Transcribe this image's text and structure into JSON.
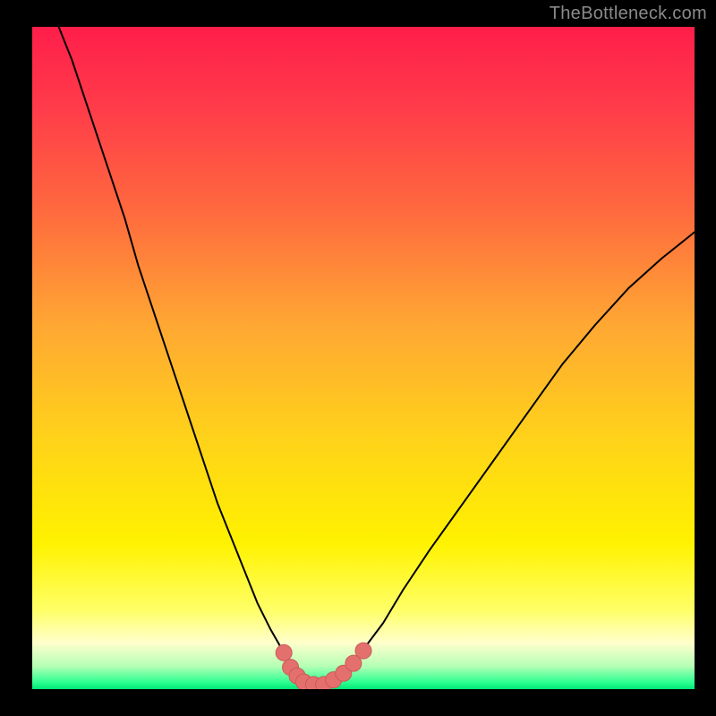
{
  "watermark": "TheBottleneck.com",
  "colors": {
    "background": "#000000",
    "gradient_stops": [
      {
        "offset": 0.0,
        "color": "#ff1e4a"
      },
      {
        "offset": 0.12,
        "color": "#ff3b4a"
      },
      {
        "offset": 0.28,
        "color": "#ff6a3e"
      },
      {
        "offset": 0.45,
        "color": "#ffa733"
      },
      {
        "offset": 0.62,
        "color": "#ffd21a"
      },
      {
        "offset": 0.78,
        "color": "#fff200"
      },
      {
        "offset": 0.88,
        "color": "#ffff66"
      },
      {
        "offset": 0.93,
        "color": "#ffffcc"
      },
      {
        "offset": 0.965,
        "color": "#b6ffb6"
      },
      {
        "offset": 0.99,
        "color": "#2bff90"
      },
      {
        "offset": 1.0,
        "color": "#00e676"
      }
    ],
    "curve": "#000000",
    "marker_fill": "#e4706e",
    "marker_stroke": "#c95a58"
  },
  "chart_data": {
    "type": "line",
    "title": "",
    "xlabel": "",
    "ylabel": "",
    "xlim": [
      0,
      100
    ],
    "ylim": [
      0,
      100
    ],
    "series": [
      {
        "name": "bottleneck-curve",
        "x": [
          4,
          6,
          8,
          10,
          12,
          14,
          16,
          18,
          20,
          22,
          24,
          26,
          28,
          30,
          32,
          34,
          36,
          38,
          39,
          40,
          41,
          42,
          43,
          44,
          45,
          46,
          48,
          50,
          53,
          56,
          60,
          65,
          70,
          75,
          80,
          85,
          90,
          95,
          100
        ],
        "y": [
          100,
          95,
          89,
          83,
          77,
          71,
          64,
          58,
          52,
          46,
          40,
          34,
          28,
          23,
          18,
          13,
          9,
          5.5,
          4,
          2.8,
          1.9,
          1.2,
          0.6,
          0.4,
          0.7,
          1.4,
          3.2,
          6,
          10,
          15,
          21,
          28,
          35,
          42,
          49,
          55,
          60.5,
          65,
          69
        ]
      }
    ],
    "markers": {
      "name": "valley-markers",
      "points": [
        {
          "x": 38.0,
          "y": 5.5
        },
        {
          "x": 39.0,
          "y": 3.3
        },
        {
          "x": 40.0,
          "y": 2
        },
        {
          "x": 41.0,
          "y": 1.1
        },
        {
          "x": 42.5,
          "y": 0.7
        },
        {
          "x": 44.0,
          "y": 0.7
        },
        {
          "x": 45.5,
          "y": 1.4
        },
        {
          "x": 47.0,
          "y": 2.4
        },
        {
          "x": 48.5,
          "y": 3.9
        },
        {
          "x": 50.0,
          "y": 5.8
        }
      ],
      "radius": 9
    }
  }
}
